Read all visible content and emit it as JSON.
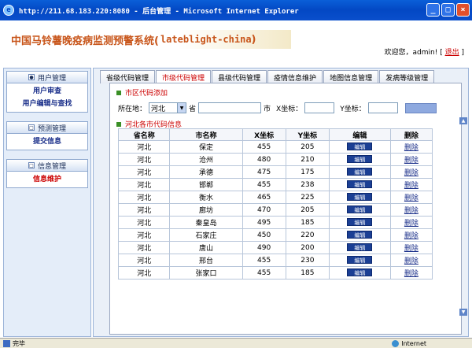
{
  "window": {
    "title": "http://211.68.183.220:8080 - 后台管理 - Microsoft Internet Explorer",
    "ie_icon": "e",
    "minimize": "_",
    "maximize": "□",
    "close": "×"
  },
  "header": {
    "system_title": "中国马铃薯晚疫病监测预警系统(",
    "system_title_latin": "lateblight-china",
    "system_title_end": ")",
    "welcome_text": "欢迎您，admin!  [",
    "logout_label": "退出",
    "welcome_end": "]"
  },
  "sidebar": {
    "groups": [
      {
        "title": "用户管理",
        "items": [
          "用户审查",
          "用户编辑与查找"
        ]
      },
      {
        "title": "预测管理",
        "items": [
          "提交信息"
        ]
      },
      {
        "title": "信息管理",
        "items": [
          "信息维护"
        ]
      }
    ]
  },
  "tabs": [
    "省级代码管理",
    "市级代码管理",
    "县级代码管理",
    "疫情信息维护",
    "地图信息管理",
    "发病等级管理"
  ],
  "add_section": {
    "title": "市区代码添加",
    "location_label": "所在地：",
    "province_selected": "河北",
    "province_suffix": "省",
    "city_suffix": "市",
    "x_label": "X坐标：",
    "y_label": "Y坐标："
  },
  "list_section": {
    "title": "河北各市代码信息",
    "columns": [
      "省名称",
      "市名称",
      "X坐标",
      "Y坐标",
      "编辑",
      "删除"
    ],
    "edit_label": "编辑",
    "delete_label": "删除",
    "rows": [
      [
        "河北",
        "保定",
        "455",
        "205"
      ],
      [
        "河北",
        "沧州",
        "480",
        "210"
      ],
      [
        "河北",
        "承德",
        "475",
        "175"
      ],
      [
        "河北",
        "邯郸",
        "455",
        "238"
      ],
      [
        "河北",
        "衡水",
        "465",
        "225"
      ],
      [
        "河北",
        "廊坊",
        "470",
        "205"
      ],
      [
        "河北",
        "秦皇岛",
        "495",
        "185"
      ],
      [
        "河北",
        "石家庄",
        "450",
        "220"
      ],
      [
        "河北",
        "唐山",
        "490",
        "200"
      ],
      [
        "河北",
        "邢台",
        "455",
        "230"
      ],
      [
        "河北",
        "张家口",
        "455",
        "185"
      ]
    ]
  },
  "statusbar": {
    "status": "完毕",
    "zone": "Internet"
  },
  "colors": {
    "accent_red": "#cc0000",
    "link_blue": "#1a2f8a",
    "titlebar_blue": "#0348c4"
  }
}
